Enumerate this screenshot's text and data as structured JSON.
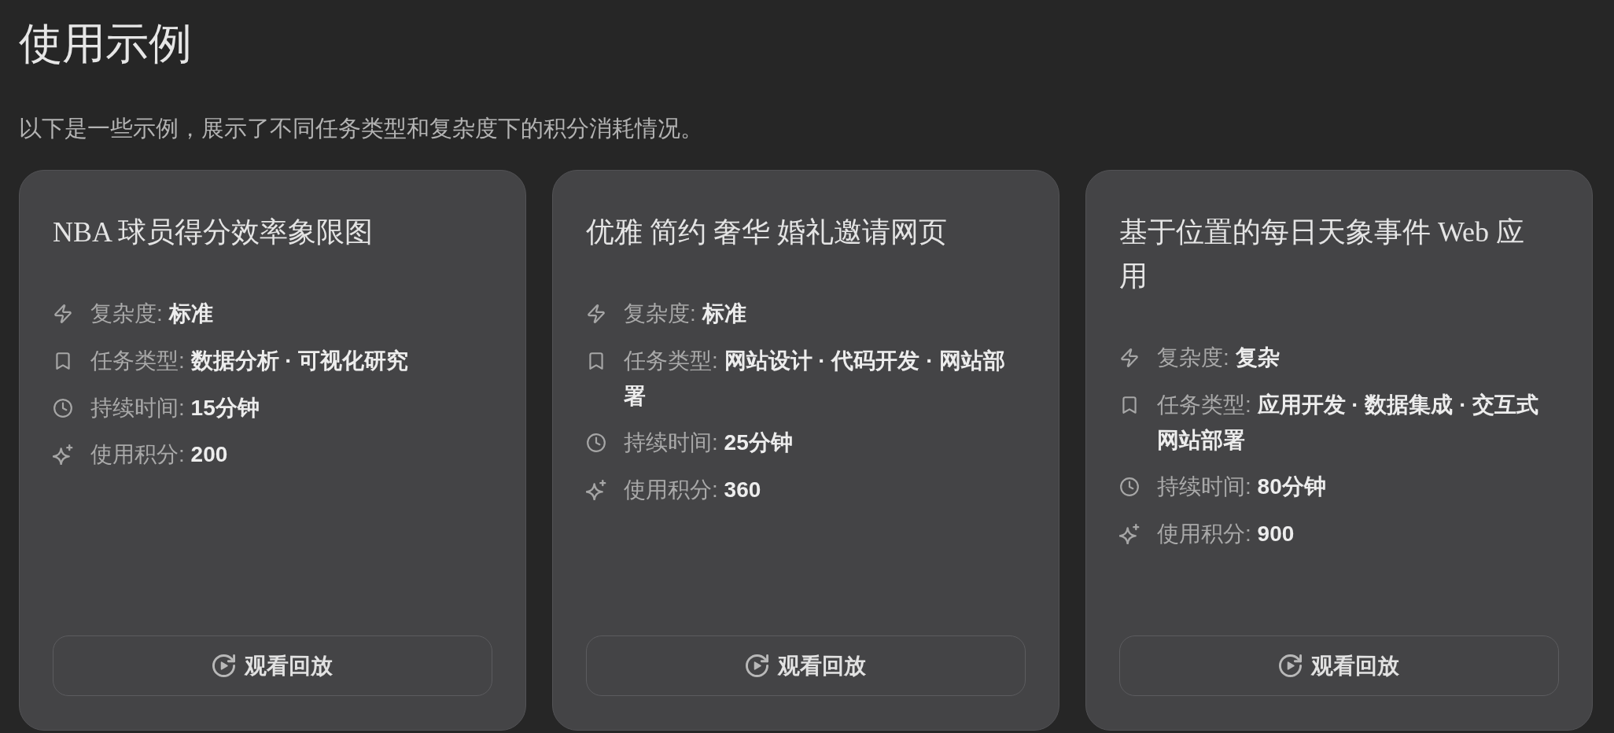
{
  "page_title": "使用示例",
  "intro": "以下是一些示例，展示了不同任务类型和复杂度下的积分消耗情况。",
  "examples": [
    {
      "title": "NBA 球员得分效率象限图",
      "details": [
        {
          "kind": "complexity",
          "label": "复杂度:",
          "value": "标准"
        },
        {
          "kind": "task_type",
          "label": "任务类型:",
          "value": "数据分析 · 可视化研究"
        },
        {
          "kind": "duration",
          "label": "持续时间:",
          "value": "15分钟"
        },
        {
          "kind": "credits",
          "label": "使用积分:",
          "value": "200"
        }
      ],
      "button": {
        "label": "观看回放"
      }
    },
    {
      "title": "优雅 简约 奢华 婚礼邀请网页",
      "details": [
        {
          "kind": "complexity",
          "label": "复杂度:",
          "value": "标准"
        },
        {
          "kind": "task_type",
          "label": "任务类型:",
          "value": "网站设计 · 代码开发 · 网站部署"
        },
        {
          "kind": "duration",
          "label": "持续时间:",
          "value": "25分钟"
        },
        {
          "kind": "credits",
          "label": "使用积分:",
          "value": "360"
        }
      ],
      "button": {
        "label": "观看回放"
      }
    },
    {
      "title": "基于位置的每日天象事件 Web 应用",
      "details": [
        {
          "kind": "complexity",
          "label": "复杂度:",
          "value": "复杂"
        },
        {
          "kind": "task_type",
          "label": "任务类型:",
          "value": "应用开发 · 数据集成 · 交互式网站部署"
        },
        {
          "kind": "duration",
          "label": "持续时间:",
          "value": "80分钟"
        },
        {
          "kind": "credits",
          "label": "使用积分:",
          "value": "900"
        }
      ],
      "button": {
        "label": "观看回放"
      }
    }
  ]
}
